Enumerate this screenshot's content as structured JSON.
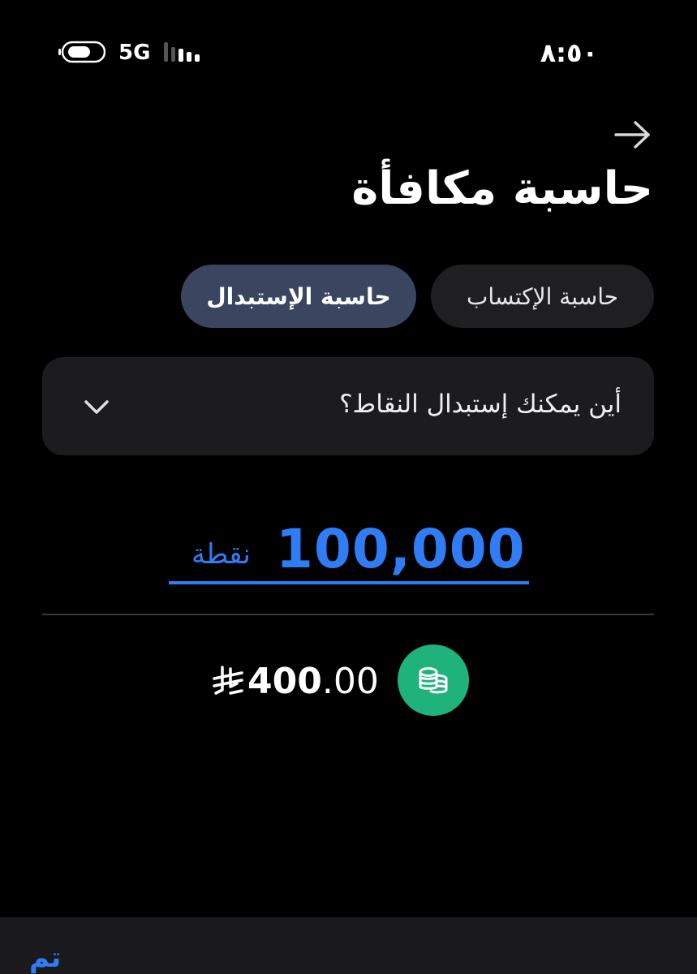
{
  "status_bar": {
    "time": "٨:٥٠",
    "network": "5G"
  },
  "header": {
    "title": "حاسبة مكافأة"
  },
  "tabs": [
    {
      "label": "حاسبة الإكتساب",
      "active": false
    },
    {
      "label": "حاسبة الإستبدال",
      "active": true
    }
  ],
  "dropdown": {
    "label": "أين يمكنك إستبدال النقاط؟"
  },
  "points": {
    "value": "100,000",
    "unit": "نقطة"
  },
  "result": {
    "amount_int": "400",
    "amount_dec": ".00",
    "currency_icon": "saudi-riyal-icon",
    "badge_icon": "coins-icon"
  },
  "bottom_bar": {
    "done_label": "تم"
  },
  "colors": {
    "accent": "#2f7df6",
    "badge": "#1db37a",
    "active_tab": "#3a4560",
    "inactive_tab": "#1f1f21"
  }
}
